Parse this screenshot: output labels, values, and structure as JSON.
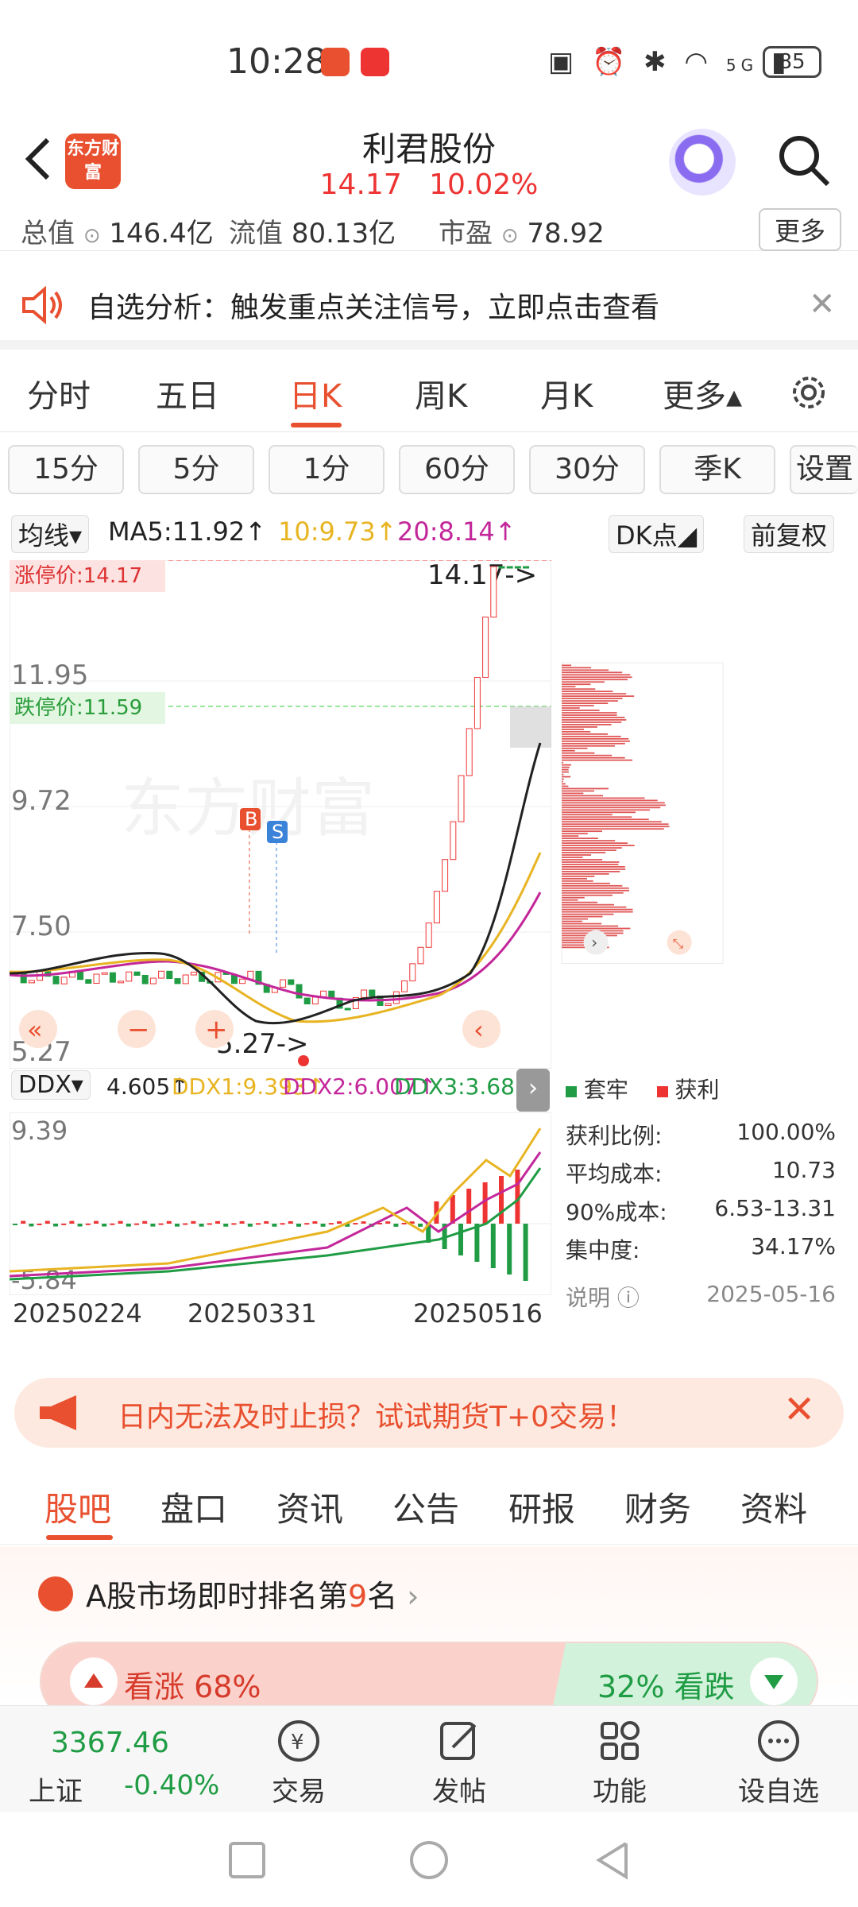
{
  "status": {
    "time": "10:28",
    "network": "5G",
    "battery": "85"
  },
  "header": {
    "logo_text": "东方财富",
    "stock_name": "利君股份",
    "price": "14.17",
    "change_pct": "10.02%"
  },
  "metrics": {
    "total_label": "总值",
    "total_value": "146.4亿",
    "float_label": "流值",
    "float_value": "80.13亿",
    "pe_label": "市盈",
    "pe_value": "78.92",
    "more": "更多"
  },
  "notice": {
    "text": "自选分析：触发重点关注信号，立即点击查看"
  },
  "ktabs": [
    {
      "label": "分时"
    },
    {
      "label": "五日"
    },
    {
      "label": "日K"
    },
    {
      "label": "周K"
    },
    {
      "label": "月K"
    },
    {
      "label": "更多▴"
    }
  ],
  "periods": [
    "15分",
    "5分",
    "1分",
    "60分",
    "30分",
    "季K",
    "设置"
  ],
  "ma": {
    "selector": "均线▾",
    "ma5": "MA5:11.92↑",
    "ma10": "10:9.73↑",
    "ma20": "20:8.14↑",
    "dk": "DK点◢",
    "fq": "前复权"
  },
  "chart": {
    "limit_up": "涨停价:14.17",
    "limit_down": "跌停价:11.59",
    "y_ticks": [
      "11.95",
      "9.72",
      "7.50",
      "5.27"
    ],
    "last_marker": "14.17->",
    "low_marker": "5.27->",
    "b_label": "B",
    "s_label": "S",
    "watermark": "东方财富"
  },
  "ddx": {
    "selector": "DDX▾",
    "ddx": "4.605↑",
    "ddx1": "DDX1:9.393↑",
    "ddx2": "DDX2:6.007↑",
    "ddx3": "DDX3:3.683↑",
    "top": "9.39",
    "bottom": "-5.84"
  },
  "dates": [
    "20250224",
    "20250331",
    "20250516"
  ],
  "chips": {
    "legend_trapped": "套牢",
    "legend_profit": "获利",
    "rows": [
      {
        "label": "获利比例:",
        "value": "100.00%"
      },
      {
        "label": "平均成本:",
        "value": "10.73"
      },
      {
        "label": "90%成本:",
        "value": "6.53-13.31"
      },
      {
        "label": "集中度:",
        "value": "34.17%"
      }
    ],
    "note": "说明",
    "date": "2025-05-16"
  },
  "ad": {
    "text": "日内无法及时止损？试试期货T+0交易！"
  },
  "btabs": [
    {
      "label": "股吧"
    },
    {
      "label": "盘口"
    },
    {
      "label": "资讯"
    },
    {
      "label": "公告"
    },
    {
      "label": "研报"
    },
    {
      "label": "财务"
    },
    {
      "label": "资料"
    }
  ],
  "rank": {
    "prefix": "A股市场即时排名第",
    "rank": "9",
    "suffix": "名",
    "up": "看涨 68%",
    "down": "32% 看跌"
  },
  "bottombar": {
    "index_value": "3367.46",
    "index_name": "上证",
    "index_change": "-0.40%",
    "items": [
      {
        "label": "交易"
      },
      {
        "label": "发帖"
      },
      {
        "label": "功能"
      },
      {
        "label": "设自选"
      }
    ]
  },
  "colors": {
    "accent": "#e8502f",
    "up": "#e33333",
    "down": "#1f9c44",
    "ma5": "#222222",
    "ma10": "#e8b422",
    "ma20": "#c3279a"
  }
}
